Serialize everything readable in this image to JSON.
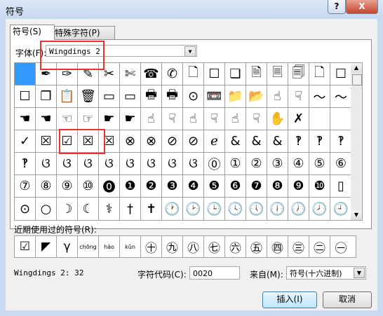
{
  "window": {
    "title": "符号",
    "help_label": "?",
    "close_label": "X"
  },
  "tabs": [
    {
      "label": "符号(S)"
    },
    {
      "label": "特殊字符(P)"
    }
  ],
  "font": {
    "label": "字体(F):",
    "value": "Wingdings 2"
  },
  "symbol_grid": [
    [
      "",
      "✒",
      "✑",
      "✎",
      "✂",
      "✄",
      "☎",
      "✆",
      "🗋",
      "☐",
      "❏",
      "🗎",
      "🗏",
      "🗐",
      "🗋",
      "☐"
    ],
    [
      "☐",
      "❐",
      "📋",
      "🗑",
      "▭",
      "▭",
      "🖶",
      "🖶",
      "⊙",
      "📼",
      "📁",
      "📂",
      "☝",
      "☟",
      "〜",
      "〜"
    ],
    [
      "☚",
      "☚",
      "☜",
      "☞",
      "☛",
      "☛",
      "☝",
      "☟",
      "☝",
      "☟",
      "☝",
      "☟",
      "✋",
      "✗",
      "",
      ""
    ],
    [
      "✓",
      "☒",
      "☑",
      "☒",
      "☒",
      "⊗",
      "⊗",
      "⊘",
      "⊘",
      "ℯ",
      "&",
      "&",
      "&",
      "‽",
      "‽",
      "‽"
    ],
    [
      "‽",
      "ଓ",
      "ଓ",
      "ଓ",
      "ଓ",
      "ଓ",
      "ଓ",
      "ଓ",
      "ଓ",
      "⓪",
      "①",
      "②",
      "③",
      "④",
      "⑤",
      "⑥"
    ],
    [
      "⑦",
      "⑧",
      "⑨",
      "⑩",
      "⓿",
      "❶",
      "❷",
      "❸",
      "❹",
      "❺",
      "❻",
      "❼",
      "❽",
      "❾",
      "❿",
      "▯"
    ],
    [
      "⊙",
      "○",
      "☽",
      "☾",
      "⚕",
      "†",
      "✝",
      "🕐",
      "🕑",
      "🕒",
      "🕓",
      "🕔",
      "🕕",
      "🕖",
      "🕗",
      "🕘"
    ]
  ],
  "recent": {
    "label": "近期使用过的符号(R):",
    "items": [
      "☑",
      "◤",
      "γ",
      "chōng",
      "hào",
      "kǔn",
      "㊉",
      "㊈",
      "㊇",
      "㊆",
      "㊅",
      "㊄",
      "㊃",
      "㊂",
      "㊁",
      "㊀"
    ]
  },
  "status": {
    "font_code": "Wingdings 2: 32"
  },
  "char_code": {
    "label": "字符代码(C):",
    "value": "0020"
  },
  "from": {
    "label": "来自(M):",
    "value": "符号(十六进制)"
  },
  "buttons": {
    "insert": "插入(I)",
    "cancel": "取消"
  },
  "colors": {
    "selected_cell": "#3399ff",
    "highlight_box": "#e63333"
  }
}
